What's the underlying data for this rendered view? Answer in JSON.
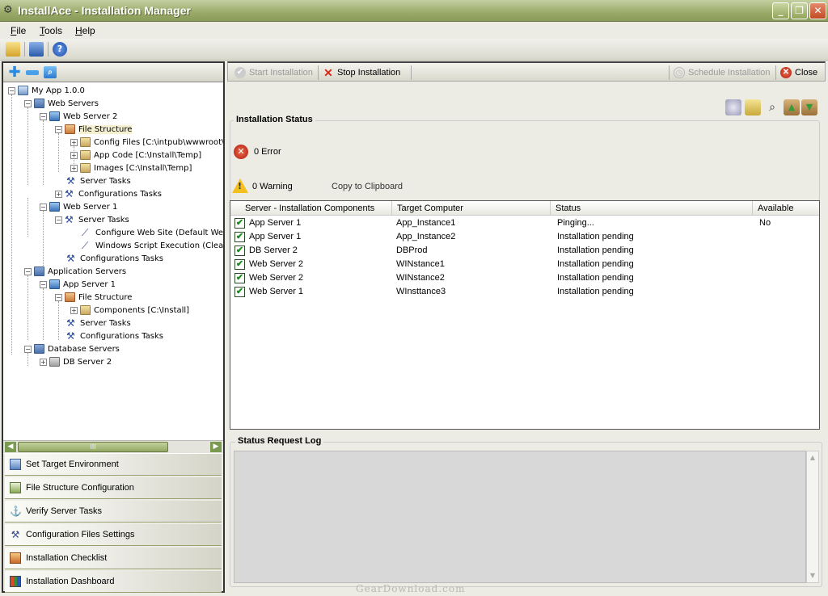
{
  "window": {
    "title": "InstallAce - Installation Manager",
    "minimize": "_",
    "maximize": "❐",
    "close": "✕"
  },
  "menu": {
    "file": "File",
    "tools": "Tools",
    "help": "Help"
  },
  "tree": {
    "root": "My App 1.0.0",
    "web_servers": "Web Servers",
    "web_server_2": "Web Server 2",
    "file_structure": "File Structure",
    "config_files": "Config Files [C:\\intpub\\wwwroot\\",
    "app_code": "App Code [C:\\Install\\Temp]",
    "images": "Images [C:\\Install\\Temp]",
    "server_tasks": "Server Tasks",
    "configurations_tasks": "Configurations Tasks",
    "web_server_1": "Web Server 1",
    "ws1_server_tasks": "Server Tasks",
    "configure_web_site": "Configure Web Site (Default Web",
    "windows_script": "Windows Script Execution (Clear",
    "ws1_configurations_tasks": "Configurations Tasks",
    "application_servers": "Application Servers",
    "app_server_1": "App Server 1",
    "as1_file_structure": "File Structure",
    "components": "Components [C:\\Install]",
    "as1_server_tasks": "Server Tasks",
    "as1_configurations_tasks": "Configurations Tasks",
    "database_servers": "Database Servers",
    "db_server_2": "DB Server 2"
  },
  "scroll_grip": "III",
  "nav": {
    "set_target": "Set Target Environment",
    "file_structure_config": "File Structure Configuration",
    "verify_server_tasks": "Verify Server Tasks",
    "configuration_files": "Configuration Files Settings",
    "installation_checklist": "Installation Checklist",
    "installation_dashboard": "Installation Dashboard"
  },
  "actions": {
    "start_installation": "Start Installation",
    "stop_installation": "Stop Installation",
    "schedule_installation": "Schedule Installation",
    "close": "Close"
  },
  "status": {
    "group_title": "Installation Status",
    "error_text": "0 Error",
    "warning_text": "0 Warning",
    "copy_to_clipboard": "Copy to Clipboard"
  },
  "grid": {
    "columns": [
      "Server - Installation Components",
      "Target Computer",
      "Status",
      "Available"
    ],
    "rows": [
      {
        "component": "App Server 1",
        "target": "App_Instance1",
        "status": "Pinging...",
        "available": "No"
      },
      {
        "component": "App Server 1",
        "target": "App_Instance2",
        "status": "Installation pending",
        "available": ""
      },
      {
        "component": "DB Server 2",
        "target": "DBProd",
        "status": "Installation pending",
        "available": ""
      },
      {
        "component": "Web Server 2",
        "target": "WINstance1",
        "status": "Installation pending",
        "available": ""
      },
      {
        "component": "Web Server 2",
        "target": "WINstance2",
        "status": "Installation pending",
        "available": ""
      },
      {
        "component": "Web Server 1",
        "target": "WInsttance3",
        "status": "Installation pending",
        "available": ""
      }
    ]
  },
  "log": {
    "group_title": "Status Request Log"
  },
  "watermark": "GearDownload.com",
  "colors": {
    "titlebar": "#9aaa68",
    "accent_green": "#7a9a50",
    "error_red": "#b41c10",
    "warning_yellow": "#f4c020"
  }
}
